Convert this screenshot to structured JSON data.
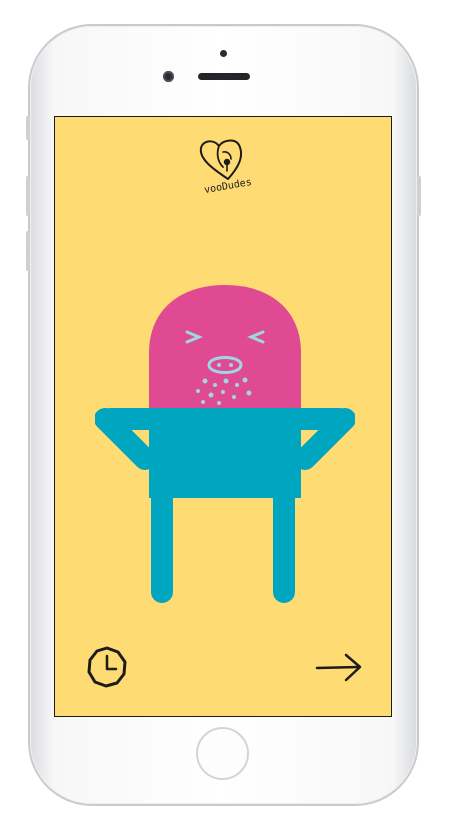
{
  "app": {
    "brand": "vooDudes"
  },
  "character": {
    "head_color": "#df4a93",
    "body_color": "#00a6bf",
    "feature_color": "#9fd6e6",
    "expression": "sneezing"
  },
  "colors": {
    "screen_background": "#ffdb73",
    "ink": "#1c1c1c"
  },
  "controls": {
    "timer_icon": "clock-icon",
    "next_icon": "arrow-right-icon"
  }
}
